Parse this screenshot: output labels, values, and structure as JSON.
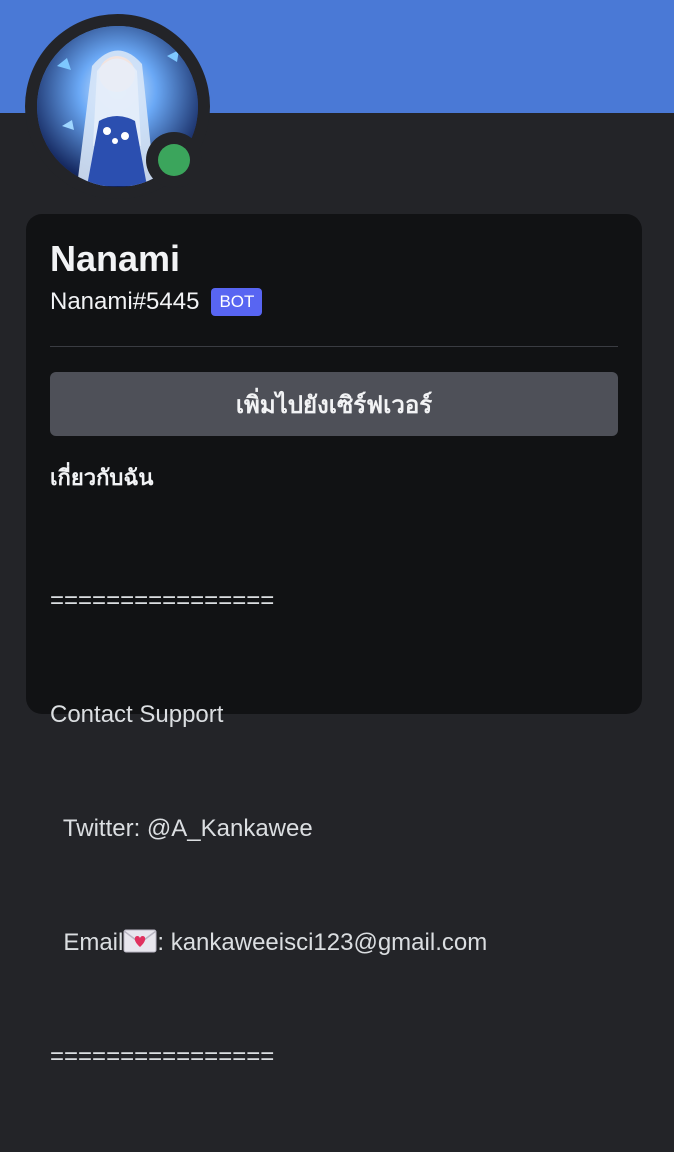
{
  "profile": {
    "display_name": "Nanami",
    "username": "Nanami#5445",
    "badge": "BOT",
    "status": "online",
    "banner_color": "#4a79d6",
    "status_color": "#3ba55c"
  },
  "actions": {
    "add_to_server_label": "เพิ่มไปยังเซิร์ฟเวอร์"
  },
  "about": {
    "heading": "เกี่ยวกับฉัน",
    "lines": {
      "sep_top": "================",
      "contact": "Contact Support",
      "twitter": "  Twitter: @A_Kankawee",
      "email_prefix": "  Email",
      "email_suffix": ": kankaweeisci123@gmail.com",
      "sep_bottom": "================"
    },
    "email_icon": "love-letter-icon"
  }
}
